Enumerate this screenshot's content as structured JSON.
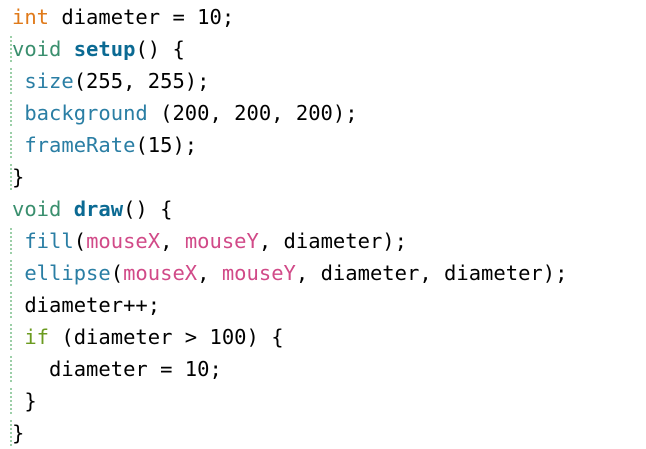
{
  "colors": {
    "default": "#000000",
    "type_int": "#e07a1a",
    "keyword_void": "#3a8f6e",
    "function_bold": "#0b6a93",
    "builtin": "#2a7ea4",
    "builtin_var": "#d14a88",
    "control": "#6b9b20",
    "gutter_marker": "#9ccfa8"
  },
  "code": {
    "lines": [
      {
        "name": "line-1",
        "gutter": false,
        "tokens": [
          {
            "text": "int",
            "color": "#e07a1a",
            "kind": "type"
          },
          {
            "text": " diameter = 10;",
            "color": "#000000",
            "kind": "plain"
          }
        ]
      },
      {
        "name": "line-2",
        "gutter": true,
        "tokens": [
          {
            "text": "void",
            "color": "#3a8f6e",
            "kind": "keyword"
          },
          {
            "text": " ",
            "color": "#000000",
            "kind": "plain"
          },
          {
            "text": "setup",
            "color": "#0b6a93",
            "kind": "function",
            "bold": true
          },
          {
            "text": "() {",
            "color": "#000000",
            "kind": "plain"
          }
        ]
      },
      {
        "name": "line-3",
        "gutter": true,
        "tokens": [
          {
            "text": " ",
            "color": "#000000",
            "kind": "plain"
          },
          {
            "text": "size",
            "color": "#2a7ea4",
            "kind": "builtin"
          },
          {
            "text": "(255, 255);",
            "color": "#000000",
            "kind": "plain"
          }
        ]
      },
      {
        "name": "line-4",
        "gutter": true,
        "tokens": [
          {
            "text": " ",
            "color": "#000000",
            "kind": "plain"
          },
          {
            "text": "background",
            "color": "#2a7ea4",
            "kind": "builtin"
          },
          {
            "text": " (200, 200, 200);",
            "color": "#000000",
            "kind": "plain"
          }
        ]
      },
      {
        "name": "line-5",
        "gutter": true,
        "tokens": [
          {
            "text": " ",
            "color": "#000000",
            "kind": "plain"
          },
          {
            "text": "frameRate",
            "color": "#2a7ea4",
            "kind": "builtin"
          },
          {
            "text": "(15);",
            "color": "#000000",
            "kind": "plain"
          }
        ]
      },
      {
        "name": "line-6",
        "gutter": true,
        "tokens": [
          {
            "text": "}",
            "color": "#000000",
            "kind": "plain"
          }
        ]
      },
      {
        "name": "line-7",
        "gutter": false,
        "tokens": [
          {
            "text": "void",
            "color": "#3a8f6e",
            "kind": "keyword"
          },
          {
            "text": " ",
            "color": "#000000",
            "kind": "plain"
          },
          {
            "text": "draw",
            "color": "#0b6a93",
            "kind": "function",
            "bold": true
          },
          {
            "text": "() {",
            "color": "#000000",
            "kind": "plain"
          }
        ]
      },
      {
        "name": "line-8",
        "gutter": true,
        "tokens": [
          {
            "text": " ",
            "color": "#000000",
            "kind": "plain"
          },
          {
            "text": "fill",
            "color": "#2a7ea4",
            "kind": "builtin"
          },
          {
            "text": "(",
            "color": "#000000",
            "kind": "plain"
          },
          {
            "text": "mouseX",
            "color": "#d14a88",
            "kind": "builtin-var"
          },
          {
            "text": ", ",
            "color": "#000000",
            "kind": "plain"
          },
          {
            "text": "mouseY",
            "color": "#d14a88",
            "kind": "builtin-var"
          },
          {
            "text": ", diameter);",
            "color": "#000000",
            "kind": "plain"
          }
        ]
      },
      {
        "name": "line-9",
        "gutter": true,
        "tokens": [
          {
            "text": " ",
            "color": "#000000",
            "kind": "plain"
          },
          {
            "text": "ellipse",
            "color": "#2a7ea4",
            "kind": "builtin"
          },
          {
            "text": "(",
            "color": "#000000",
            "kind": "plain"
          },
          {
            "text": "mouseX",
            "color": "#d14a88",
            "kind": "builtin-var"
          },
          {
            "text": ", ",
            "color": "#000000",
            "kind": "plain"
          },
          {
            "text": "mouseY",
            "color": "#d14a88",
            "kind": "builtin-var"
          },
          {
            "text": ", diameter, diameter);",
            "color": "#000000",
            "kind": "plain"
          }
        ]
      },
      {
        "name": "line-10",
        "gutter": true,
        "tokens": [
          {
            "text": " diameter++;",
            "color": "#000000",
            "kind": "plain"
          }
        ]
      },
      {
        "name": "line-11",
        "gutter": true,
        "tokens": [
          {
            "text": " ",
            "color": "#000000",
            "kind": "plain"
          },
          {
            "text": "if",
            "color": "#6b9b20",
            "kind": "control"
          },
          {
            "text": " (diameter > 100) {",
            "color": "#000000",
            "kind": "plain"
          }
        ]
      },
      {
        "name": "line-12",
        "gutter": true,
        "tokens": [
          {
            "text": "   diameter = 10;",
            "color": "#000000",
            "kind": "plain"
          }
        ]
      },
      {
        "name": "line-13",
        "gutter": true,
        "tokens": [
          {
            "text": " }",
            "color": "#000000",
            "kind": "plain"
          }
        ]
      },
      {
        "name": "line-14",
        "gutter": true,
        "tokens": [
          {
            "text": "}",
            "color": "#000000",
            "kind": "plain"
          }
        ]
      }
    ]
  }
}
